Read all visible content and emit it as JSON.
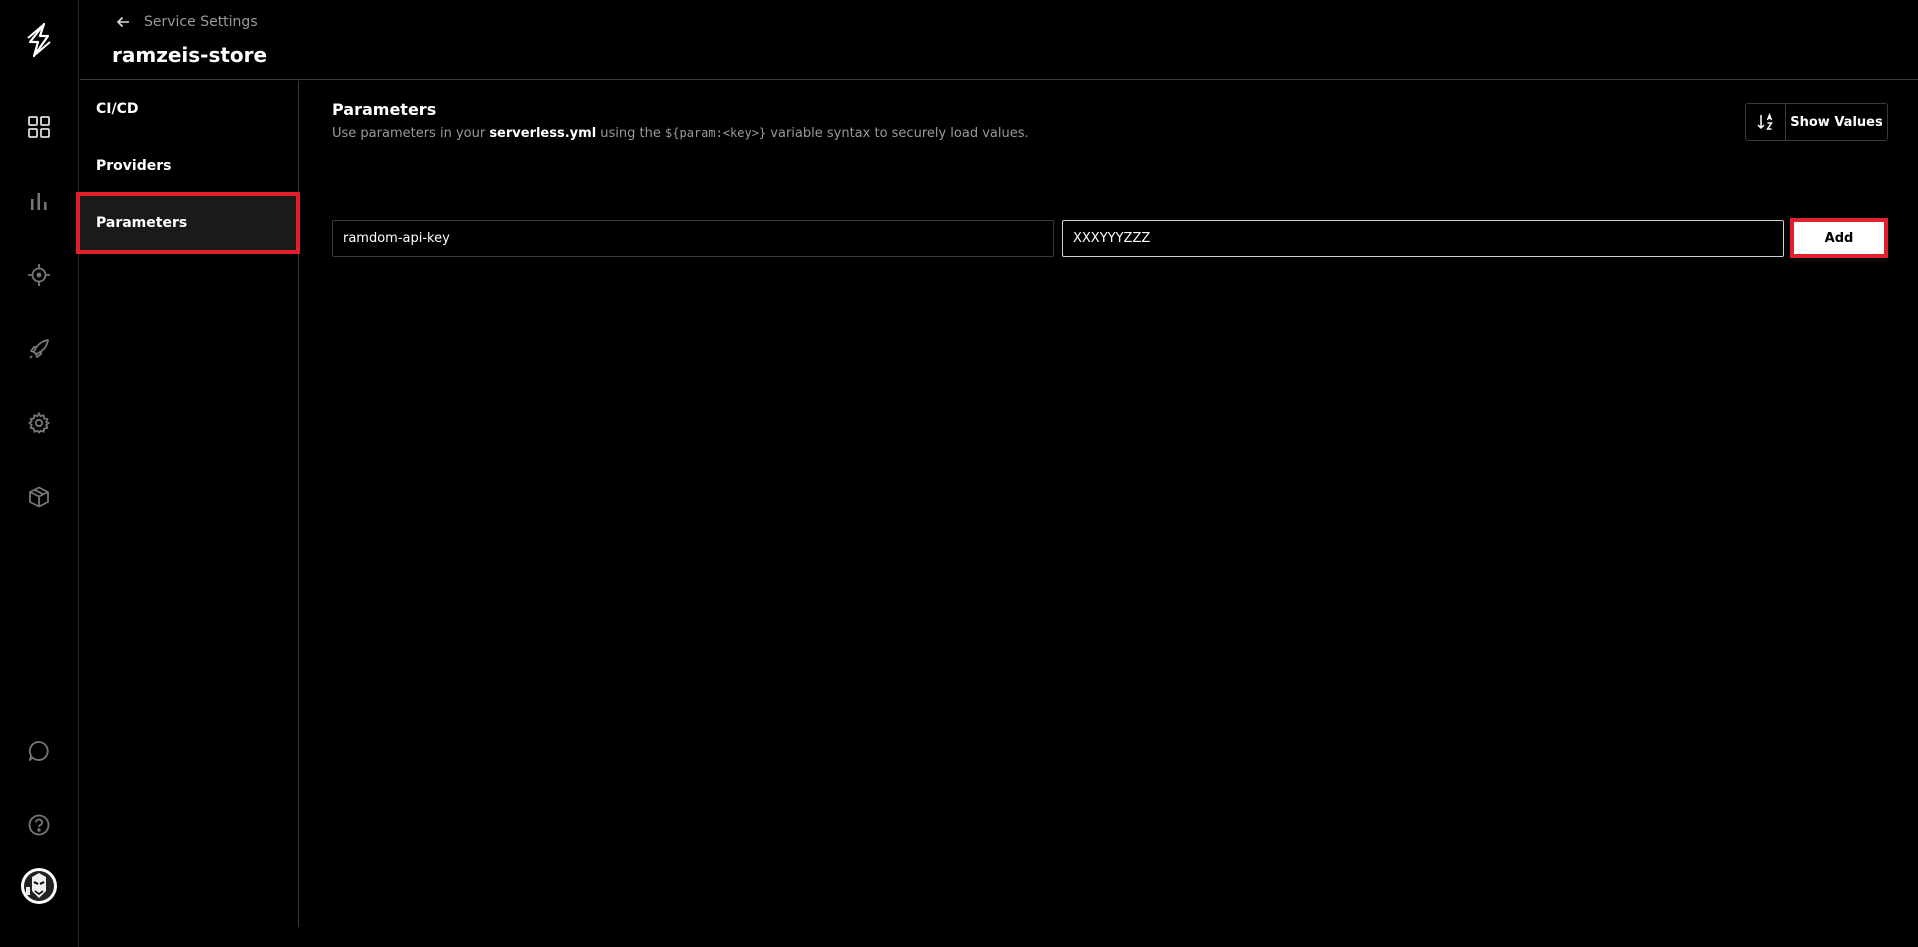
{
  "header": {
    "back_label": "Service Settings",
    "title": "ramzeis-store"
  },
  "rail": {
    "icons": [
      "logo-icon",
      "grid-icon",
      "bar-chart-icon",
      "target-icon",
      "rocket-icon",
      "gear-icon",
      "package-icon",
      "chat-icon",
      "help-icon",
      "avatar"
    ]
  },
  "nav": {
    "items": [
      {
        "label": "CI/CD"
      },
      {
        "label": "Providers"
      },
      {
        "label": "Parameters",
        "active": true
      }
    ]
  },
  "parameters": {
    "title": "Parameters",
    "desc_prefix": "Use parameters in your ",
    "desc_file": "serverless.yml",
    "desc_middle": " using the ",
    "desc_code": "${param:<key>}",
    "desc_suffix": " variable syntax to securely load values.",
    "show_values_label": "Show Values",
    "key_value": "ramdom-api-key",
    "value_value": "XXXYYYZZZ",
    "add_label": "Add"
  },
  "colors": {
    "background": "#000000",
    "border": "#3a3a3a",
    "highlight": "#e0202b",
    "muted_text": "#9a9a9a"
  }
}
